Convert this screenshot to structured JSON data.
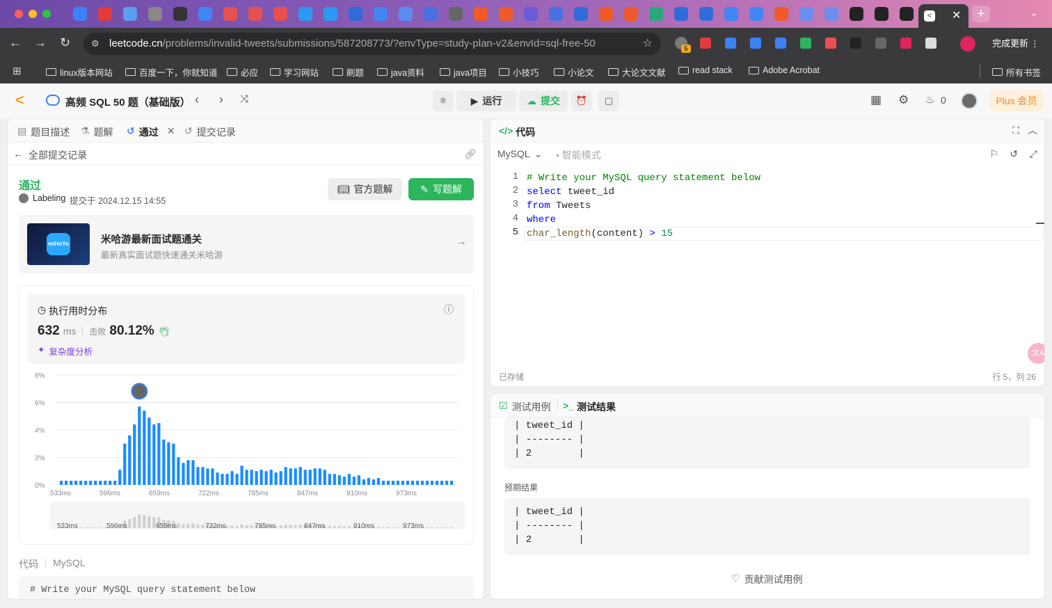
{
  "browser": {
    "url_host": "leetcode.cn",
    "url_path": "/problems/invalid-tweets/submissions/587208773/?envType=study-plan-v2&envId=sql-free-50",
    "update_label": "完成更新",
    "ext_badge": "5",
    "bookmarks": [
      "linux版本网站",
      "百度一下，你就知道",
      "必应",
      "学习网站",
      "刷题",
      "java资料",
      "java项目",
      "小技巧",
      "小论文",
      "大论文文献",
      "read stack",
      "Adobe Acrobat"
    ],
    "all_bookmarks": "所有书签"
  },
  "app": {
    "title": "高频 SQL 50 题（基础版）",
    "run_label": "运行",
    "submit_label": "提交",
    "fire_count": "0",
    "plus_label": "Plus 会员"
  },
  "left": {
    "tabs": [
      "题目描述",
      "题解",
      "通过",
      "提交记录"
    ],
    "back_label": "全部提交记录",
    "status": "通过",
    "user": "Labeling",
    "submitted_at": "提交于 2024.12.15 14:55",
    "official_label": "官方题解",
    "write_label": "写题解",
    "ad_title": "米哈游最新面试题通关",
    "ad_sub": "最新真实面试题快速通关米哈游",
    "ad_logo": "miHoYo",
    "runtime_title": "执行用时分布",
    "runtime_value": "632",
    "runtime_unit": "ms",
    "beat_label": "击败",
    "beat_value": "80.12%",
    "complexity_label": "复杂度分析",
    "code_label": "代码",
    "code_lang": "MySQL",
    "code_preview": "# Write your MySQL query statement below"
  },
  "chart_data": {
    "type": "bar",
    "ylabel": "",
    "yticks": [
      "8%",
      "6%",
      "4%",
      "2%",
      "0%"
    ],
    "ylim": [
      0,
      8
    ],
    "xticks": [
      "533ms",
      "596ms",
      "659ms",
      "722ms",
      "785ms",
      "847ms",
      "910ms",
      "973ms"
    ],
    "values": [
      0.3,
      0.3,
      0.3,
      0.3,
      0.3,
      0.3,
      0.3,
      0.3,
      0.3,
      0.3,
      0.3,
      0.3,
      1.1,
      3.0,
      3.6,
      4.4,
      5.7,
      5.4,
      4.9,
      4.4,
      4.5,
      3.3,
      3.1,
      3.0,
      2.0,
      1.6,
      1.8,
      1.8,
      1.3,
      1.3,
      1.2,
      1.2,
      0.9,
      0.8,
      0.8,
      1.0,
      0.8,
      1.4,
      1.1,
      1.1,
      1.0,
      1.1,
      1.0,
      1.1,
      0.9,
      1.0,
      1.3,
      1.2,
      1.2,
      1.3,
      1.1,
      1.1,
      1.2,
      1.2,
      1.1,
      0.8,
      0.8,
      0.7,
      0.6,
      0.8,
      0.6,
      0.7,
      0.4,
      0.5,
      0.4,
      0.5,
      0.3,
      0.3,
      0.3,
      0.3,
      0.3,
      0.3,
      0.3,
      0.3,
      0.3,
      0.3,
      0.3,
      0.3,
      0.3,
      0.3,
      0.3
    ],
    "user_marker_index": 16
  },
  "right": {
    "title": "代码",
    "lang": "MySQL",
    "smart_mode": "智能模式",
    "saved_label": "已存储",
    "cursor_pos": "行 5，列 26",
    "code": [
      "# Write your MySQL query statement below",
      "select tweet_id",
      "from Tweets",
      "where",
      "char_length(content) > 15"
    ],
    "testcase_tab": "测试用例",
    "result_tab": "测试结果",
    "output_rows": [
      "| tweet_id |",
      "| -------- |",
      "| 2        |"
    ],
    "expected_label": "预期结果",
    "expected_rows": [
      "| tweet_id |",
      "| -------- |",
      "| 2        |"
    ],
    "contribute_label": "贡献测试用例"
  }
}
